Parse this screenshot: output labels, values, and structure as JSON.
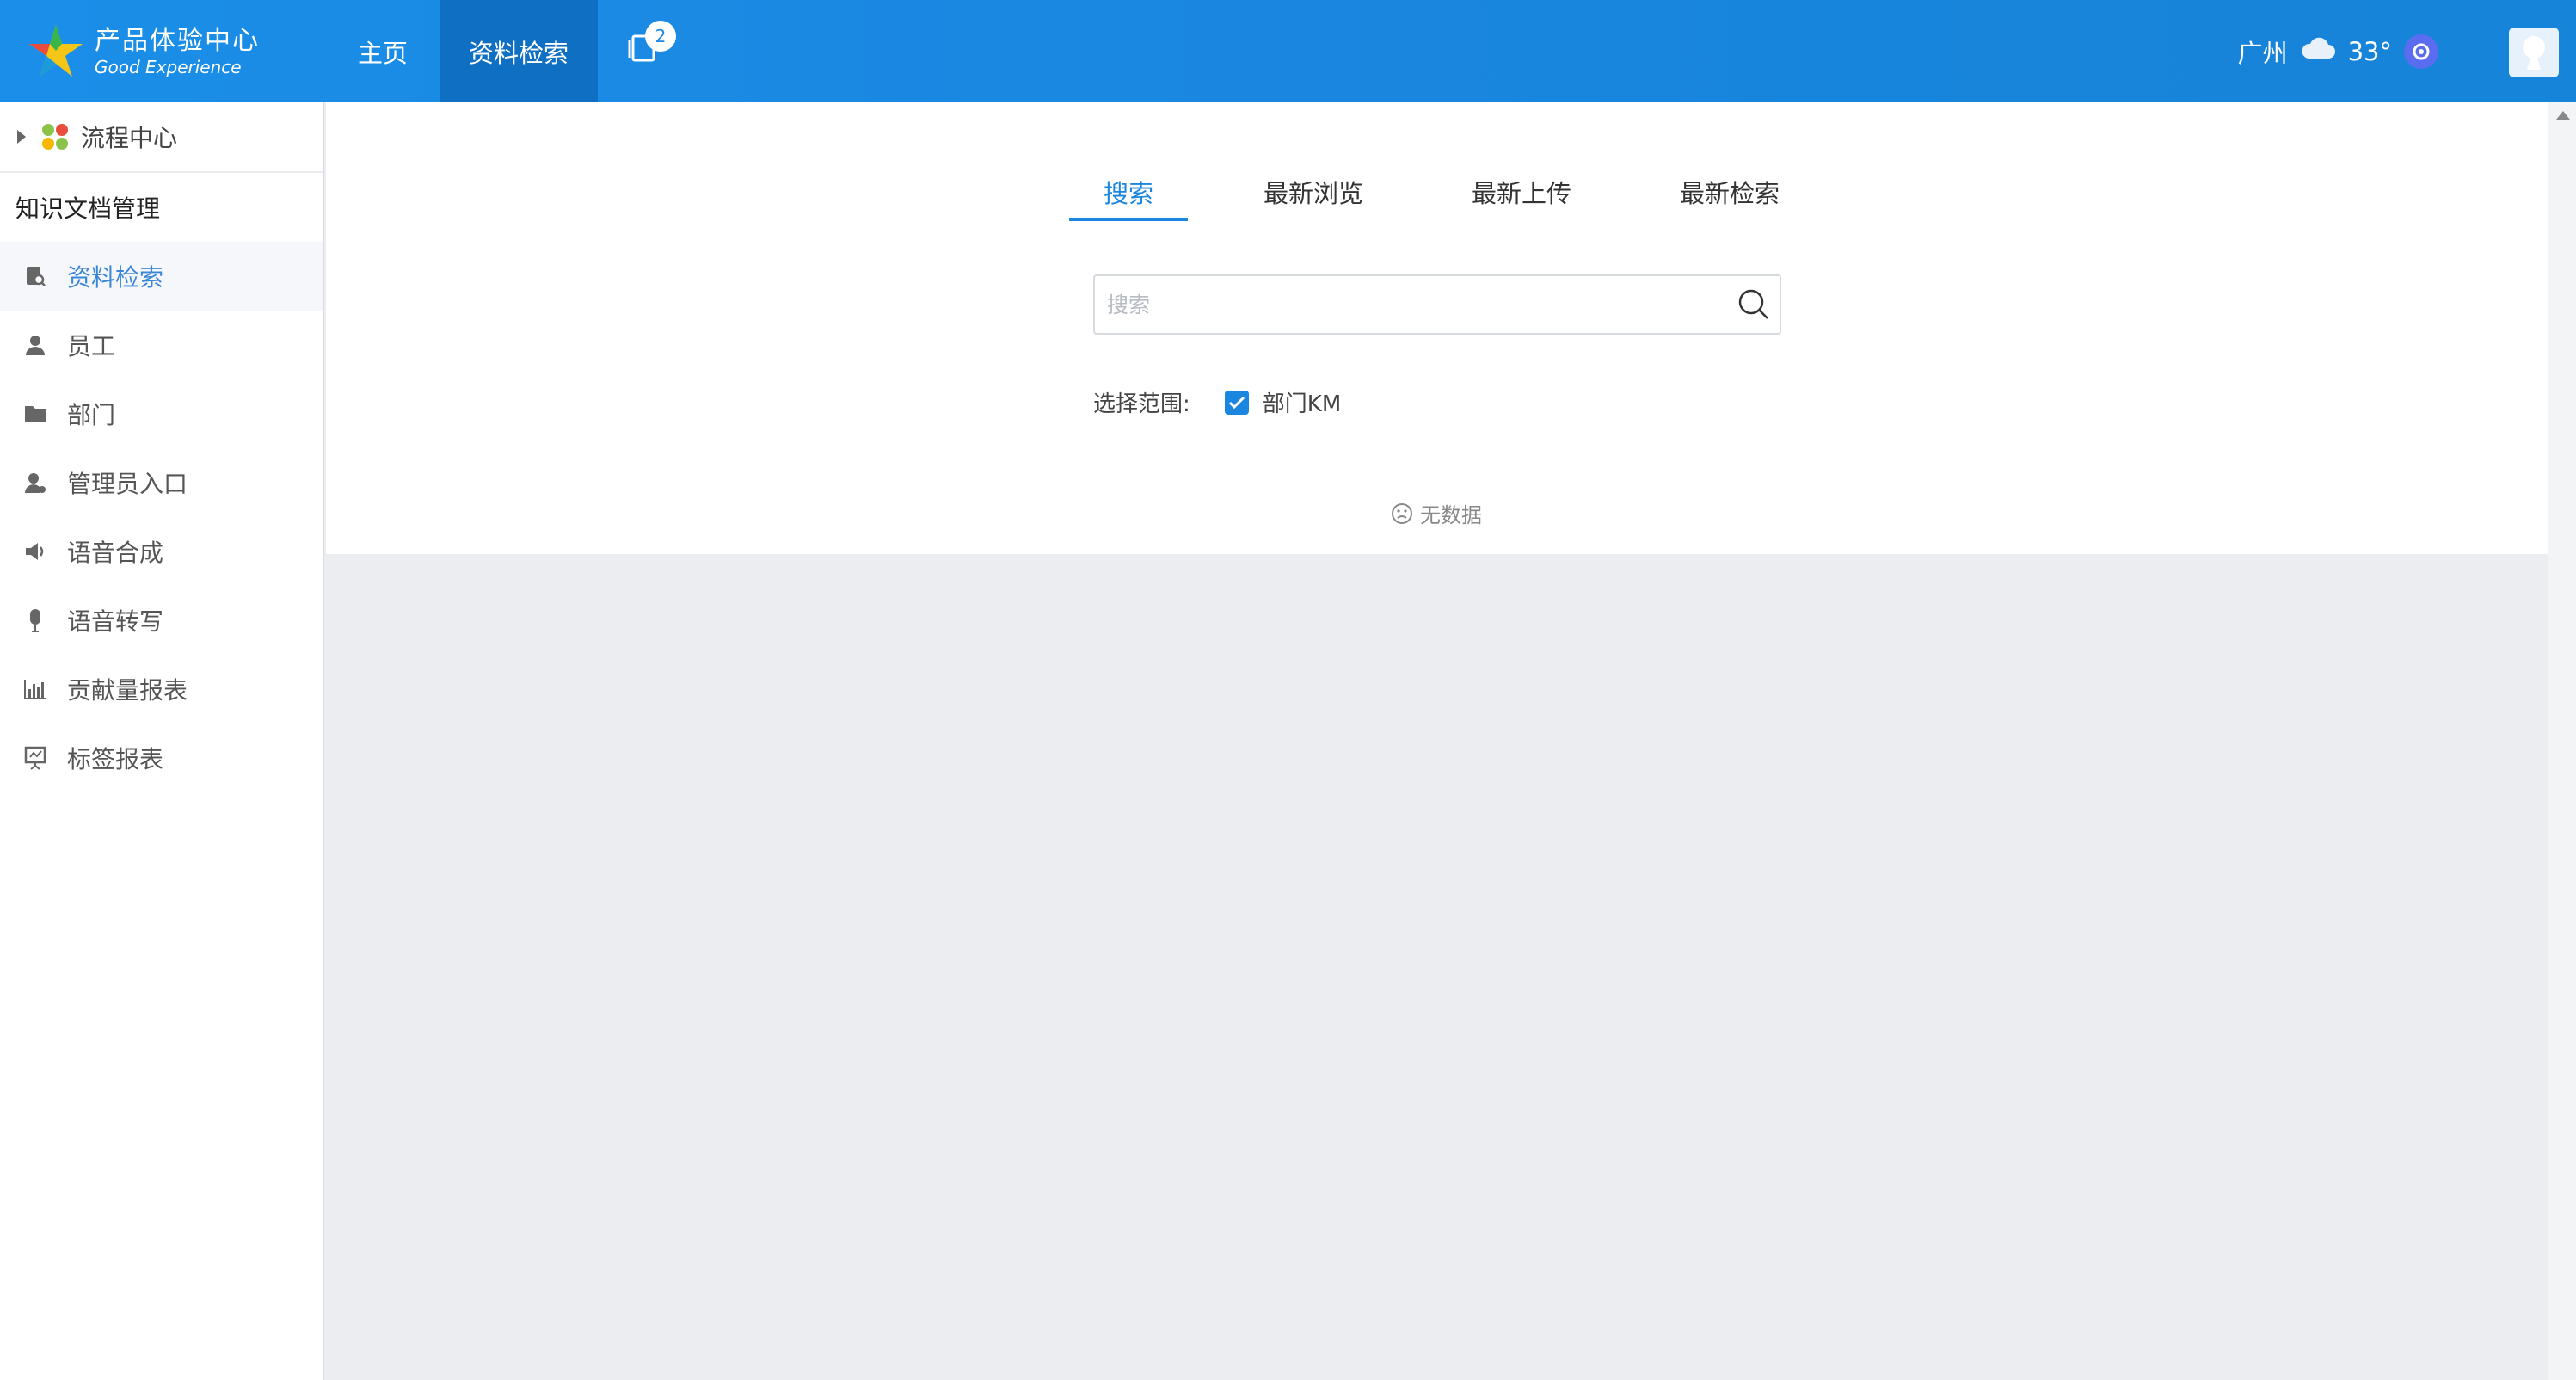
{
  "header": {
    "logo_cn": "产品体验中心",
    "logo_en": "Good Experience",
    "nav": [
      {
        "label": "主页"
      },
      {
        "label": "资料检索"
      }
    ],
    "tabs_badge": "2",
    "city": "广州",
    "weather_icon": "cloud-icon",
    "temperature": "33°"
  },
  "sidebar": {
    "top_label": "流程中心",
    "section_title": "知识文档管理",
    "items": [
      {
        "label": "资料检索",
        "icon": "document-search-icon"
      },
      {
        "label": "员工",
        "icon": "user-icon"
      },
      {
        "label": "部门",
        "icon": "folder-icon"
      },
      {
        "label": "管理员入口",
        "icon": "admin-icon"
      },
      {
        "label": "语音合成",
        "icon": "speaker-icon"
      },
      {
        "label": "语音转写",
        "icon": "microphone-icon"
      },
      {
        "label": "贡献量报表",
        "icon": "bar-chart-icon"
      },
      {
        "label": "标签报表",
        "icon": "tag-report-icon"
      }
    ]
  },
  "main": {
    "tabs": [
      {
        "label": "搜索"
      },
      {
        "label": "最新浏览"
      },
      {
        "label": "最新上传"
      },
      {
        "label": "最新检索"
      }
    ],
    "search": {
      "placeholder": "搜索",
      "value": ""
    },
    "scope_label": "选择范围:",
    "scope_option": "部门KM",
    "no_data": "无数据"
  },
  "colors": {
    "header_bg": "#1a86df",
    "accent": "#1a86df",
    "content_bg": "#ebedf0"
  }
}
